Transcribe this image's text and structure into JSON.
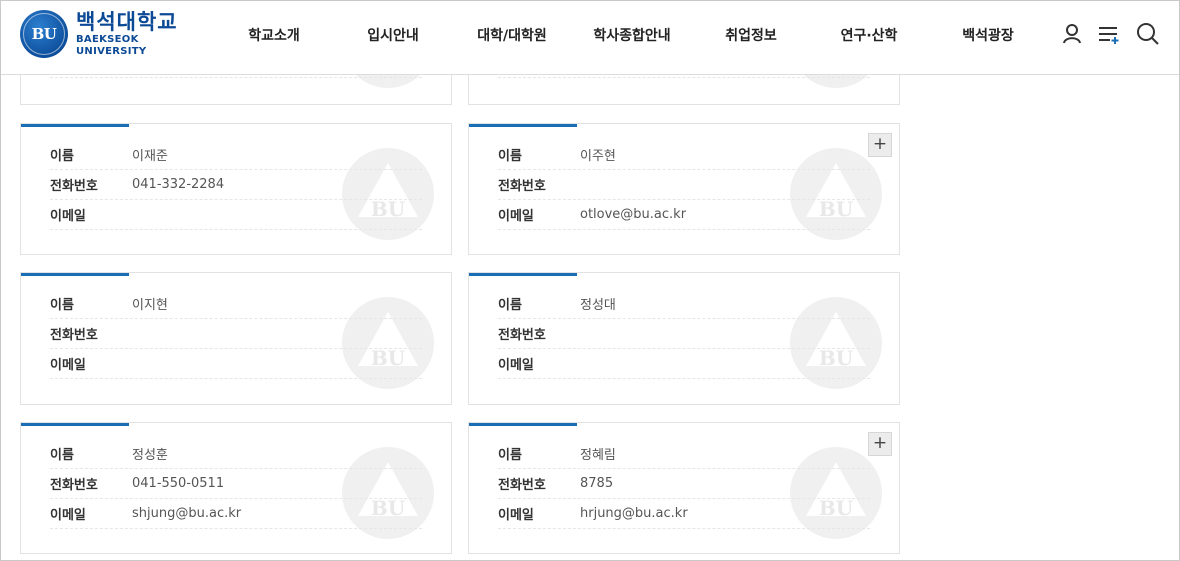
{
  "header": {
    "logo_kor": "백석대학교",
    "logo_eng": "BAEKSEOK UNIVERSITY",
    "logo_emblem": "BU",
    "nav": [
      "학교소개",
      "입시안내",
      "대학/대학원",
      "학사종합안내",
      "취업정보",
      "연구·산학",
      "백석광장"
    ],
    "utility_icons": [
      "user-icon",
      "menu-icon",
      "search-icon"
    ]
  },
  "labels": {
    "name": "이름",
    "phone": "전화번호",
    "email": "이메일"
  },
  "cards": [
    {
      "name": "",
      "phone": "",
      "email": "",
      "expandable": false
    },
    {
      "name": "",
      "phone": "",
      "email": "",
      "expandable": false
    },
    {
      "name": "이재준",
      "phone": "041-332-2284",
      "email": "",
      "expandable": false
    },
    {
      "name": "이주현",
      "phone": "",
      "email": "otlove@bu.ac.kr",
      "expandable": true
    },
    {
      "name": "이지현",
      "phone": "",
      "email": "",
      "expandable": false
    },
    {
      "name": "정성대",
      "phone": "",
      "email": "",
      "expandable": false
    },
    {
      "name": "정성훈",
      "phone": "041-550-0511",
      "email": "shjung@bu.ac.kr",
      "expandable": false
    },
    {
      "name": "정혜림",
      "phone": "8785",
      "email": "hrjung@bu.ac.kr",
      "expandable": true
    }
  ],
  "plus_label": "+",
  "colors": {
    "brand": "#0c4a96",
    "accent_bar": "#1b6eb5"
  }
}
